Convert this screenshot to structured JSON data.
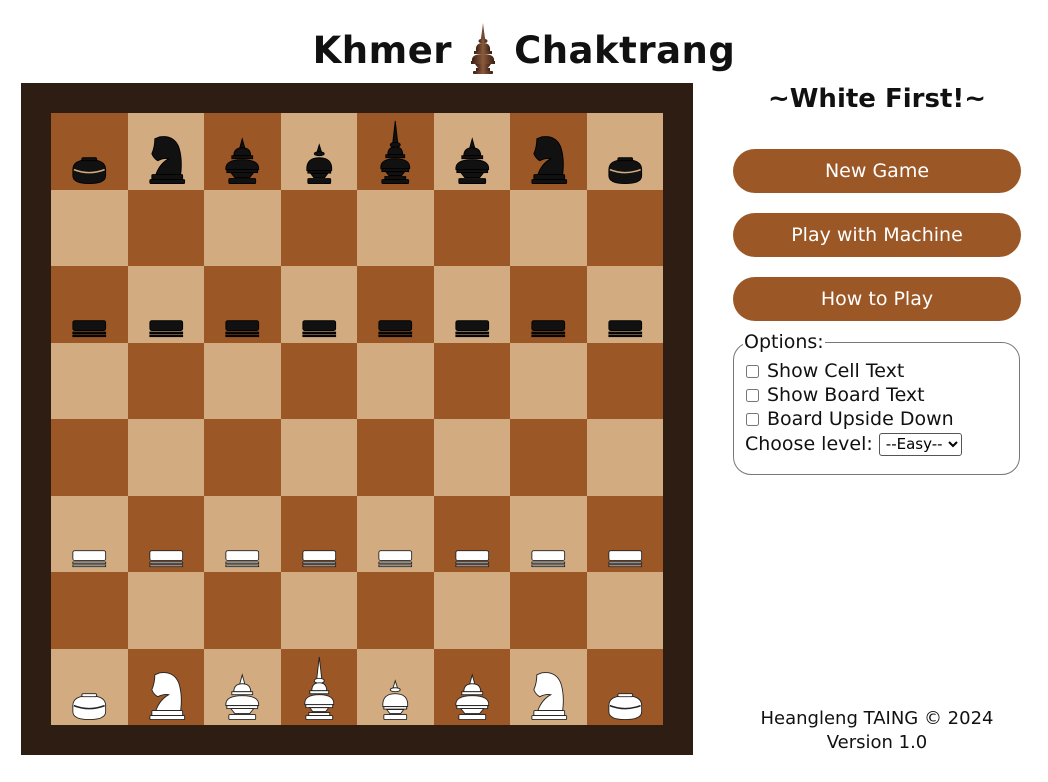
{
  "header": {
    "title_left": "Khmer",
    "title_right": "Chaktrang",
    "logo_icon": "khmer-king-piece-icon"
  },
  "board": {
    "light_color": "#d2ac80",
    "dark_color": "#9b5726",
    "frame_color": "#2e1d12",
    "rows": [
      [
        "black-boat",
        "black-horse",
        "black-noble",
        "black-queen",
        "black-king",
        "black-noble",
        "black-horse",
        "black-boat"
      ],
      [
        "",
        "",
        "",
        "",
        "",
        "",
        "",
        ""
      ],
      [
        "black-fish",
        "black-fish",
        "black-fish",
        "black-fish",
        "black-fish",
        "black-fish",
        "black-fish",
        "black-fish"
      ],
      [
        "",
        "",
        "",
        "",
        "",
        "",
        "",
        ""
      ],
      [
        "",
        "",
        "",
        "",
        "",
        "",
        "",
        ""
      ],
      [
        "white-fish",
        "white-fish",
        "white-fish",
        "white-fish",
        "white-fish",
        "white-fish",
        "white-fish",
        "white-fish"
      ],
      [
        "",
        "",
        "",
        "",
        "",
        "",
        "",
        ""
      ],
      [
        "white-boat",
        "white-horse",
        "white-noble",
        "white-king",
        "white-queen",
        "white-noble",
        "white-horse",
        "white-boat"
      ]
    ]
  },
  "sidebar": {
    "turn_text": "~White First!~",
    "buttons": {
      "new_game": "New Game",
      "play_machine": "Play with Machine",
      "how_to_play": "How to Play"
    },
    "button_color": "#9b5726",
    "options": {
      "legend": "Options:",
      "show_cell_text": "Show Cell Text",
      "show_board_text": "Show Board Text",
      "board_upside_down": "Board Upside Down",
      "choose_level": "Choose level:",
      "level_selected": "--Easy--"
    }
  },
  "footer": {
    "credit": "Heangleng TAING © 2024",
    "version": "Version 1.0"
  }
}
